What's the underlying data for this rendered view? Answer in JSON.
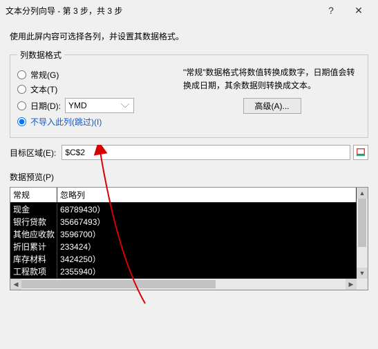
{
  "titlebar": {
    "title": "文本分列向导 - 第 3 步，共 3 步",
    "help": "?",
    "close": "✕"
  },
  "instruction": "使用此屏内容可选择各列，并设置其数据格式。",
  "fieldset_legend": "列数据格式",
  "radios": {
    "general": "常规(G)",
    "text": "文本(T)",
    "date_label": "日期(D):",
    "date_format": "YMD",
    "skip": "不导入此列(跳过)(I)",
    "selected": "skip"
  },
  "description": "\"常规\"数据格式将数值转换成数字，日期值会转换成日期，其余数据则转换成文本。",
  "advanced_btn": "高级(A)...",
  "target": {
    "label": "目标区域(E):",
    "value": "$C$2"
  },
  "preview": {
    "label": "数据预览(P)",
    "headers": [
      "常规",
      "忽略列"
    ],
    "rows": [
      [
        "现金",
        "68789430）"
      ],
      [
        "银行贷款",
        "35667493）"
      ],
      [
        "其他应收款",
        "3596700）"
      ],
      [
        "折旧累计",
        "233424）"
      ],
      [
        "库存材料",
        "3424250）"
      ],
      [
        "工程款项",
        "2355940）"
      ]
    ]
  },
  "annotation": {
    "color": "#d80000"
  }
}
